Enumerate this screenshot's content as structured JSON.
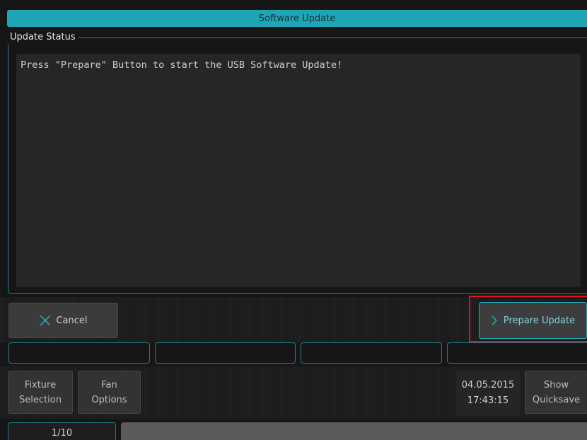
{
  "window": {
    "title": "Software Update"
  },
  "status": {
    "legend": "Update Status",
    "message": "Press \"Prepare\" Button to start the USB Software Update!"
  },
  "buttons": {
    "cancel_label": "Cancel",
    "prepare_label": "Prepare Update"
  },
  "toolbar": {
    "fixture_selection_line1": "Fixture",
    "fixture_selection_line2": "Selection",
    "fan_options_line1": "Fan",
    "fan_options_line2": "Options",
    "show_quicksave_line1": "Show",
    "show_quicksave_line2": "Quicksave"
  },
  "datetime": {
    "date": "04.05.2015",
    "time": "17:43:15"
  },
  "page": {
    "indicator": "1/10"
  },
  "icons": {
    "cancel": "close-icon",
    "prepare": "chevron-right-icon"
  },
  "colors": {
    "accent": "#1fa6b6",
    "highlight": "#e0141a"
  }
}
